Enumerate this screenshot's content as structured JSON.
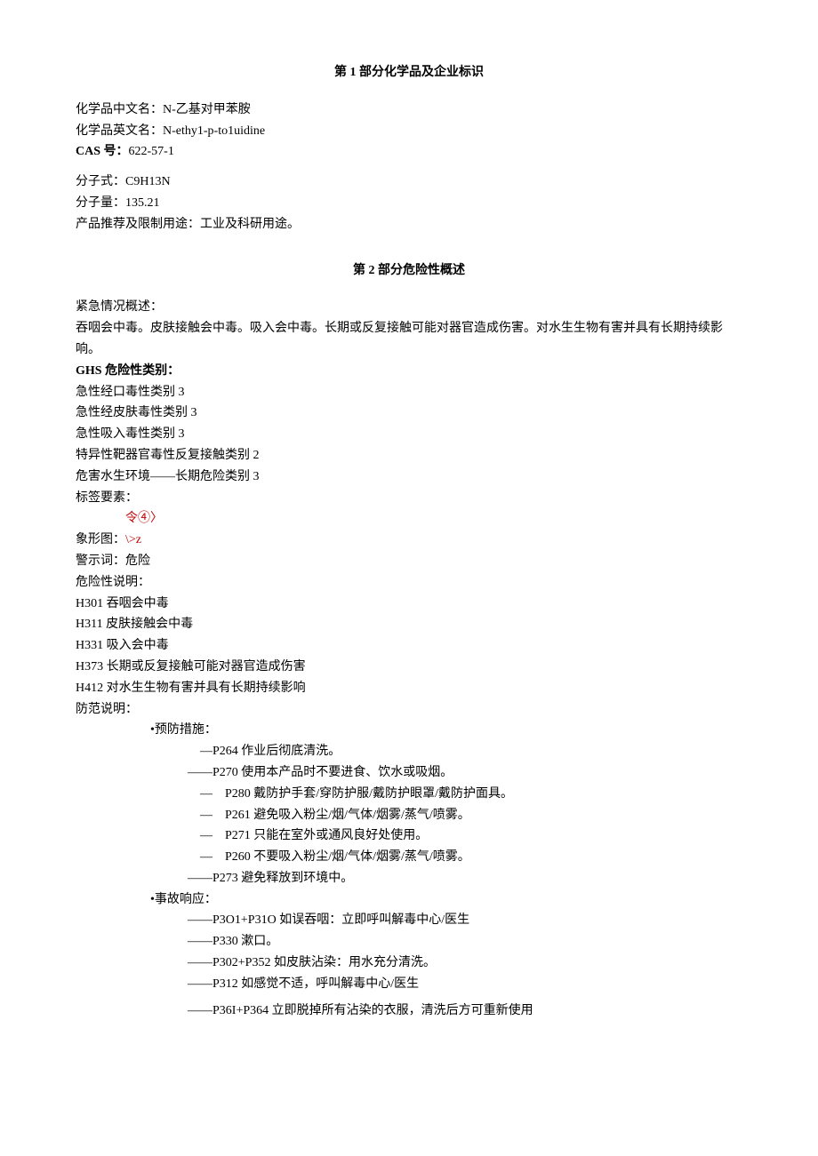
{
  "section1": {
    "heading": "第 1 部分化学品及企业标识",
    "name_cn_label": "化学品中文名：",
    "name_cn_value": "N-乙基对甲苯胺",
    "name_en_label": "化学品英文名：",
    "name_en_value": "N-ethy1-p-to1uidine",
    "cas_label": "CAS 号：",
    "cas_value": "622-57-1",
    "formula_label": "分子式：",
    "formula_value": "C9H13N",
    "weight_label": "分子量：",
    "weight_value": "135.21",
    "usage_label": "产品推荐及限制用途：",
    "usage_value": "工业及科研用途。"
  },
  "section2": {
    "heading": "第 2 部分危险性概述",
    "emergency_label": "紧急情况概述：",
    "emergency_text": "吞咽会中毒。皮肤接触会中毒。吸入会中毒。长期或反复接触可能对器官造成伤害。对水生生物有害并具有长期持续影响。",
    "ghs_label": "GHS 危险性类别：",
    "ghs_items": [
      "急性经口毒性类别 3",
      "急性经皮肤毒性类别 3",
      "急性吸入毒性类别 3",
      "特异性靶器官毒性反复接触类别 2",
      "危害水生环境——长期危险类别 3"
    ],
    "label_elements": "标签要素：",
    "pictogram_red": "令④〉",
    "pictogram_label": "象形图：",
    "pictogram_red2": "\\>z",
    "signal_label": "警示词：",
    "signal_value": "危险",
    "hazard_label": "危险性说明：",
    "hazard_items": [
      "H301 吞咽会中毒",
      "H311 皮肤接触会中毒",
      "H331 吸入会中毒",
      "H373 长期或反复接触可能对器官造成伤害",
      "H412 对水生生物有害并具有长期持续影响"
    ],
    "precaution_label": "防范说明：",
    "prevention_header": "•预防措施：",
    "prevention_items": [
      "—P264 作业后彻底清洗。",
      "——P270 使用本产品时不要进食、饮水或吸烟。",
      "—　P280 戴防护手套/穿防护服/戴防护眼罩/戴防护面具。",
      "—　P261 避免吸入粉尘/烟/气体/烟雾/蒸气/喷雾。",
      "—　P271 只能在室外或通风良好处使用。",
      "—　P260 不要吸入粉尘/烟/气体/烟雾/蒸气/喷雾。",
      "——P273 避免释放到环境中。"
    ],
    "response_header": "•事故响应：",
    "response_items": [
      "——P3O1+P31O 如误吞咽：立即呼叫解毒中心/医生",
      "——P330 漱口。",
      "——P302+P352 如皮肤沾染：用水充分清洗。",
      "——P312 如感觉不适，呼叫解毒中心/医生",
      "——P36I+P364 立即脱掉所有沾染的衣服，清洗后方可重新使用"
    ]
  }
}
